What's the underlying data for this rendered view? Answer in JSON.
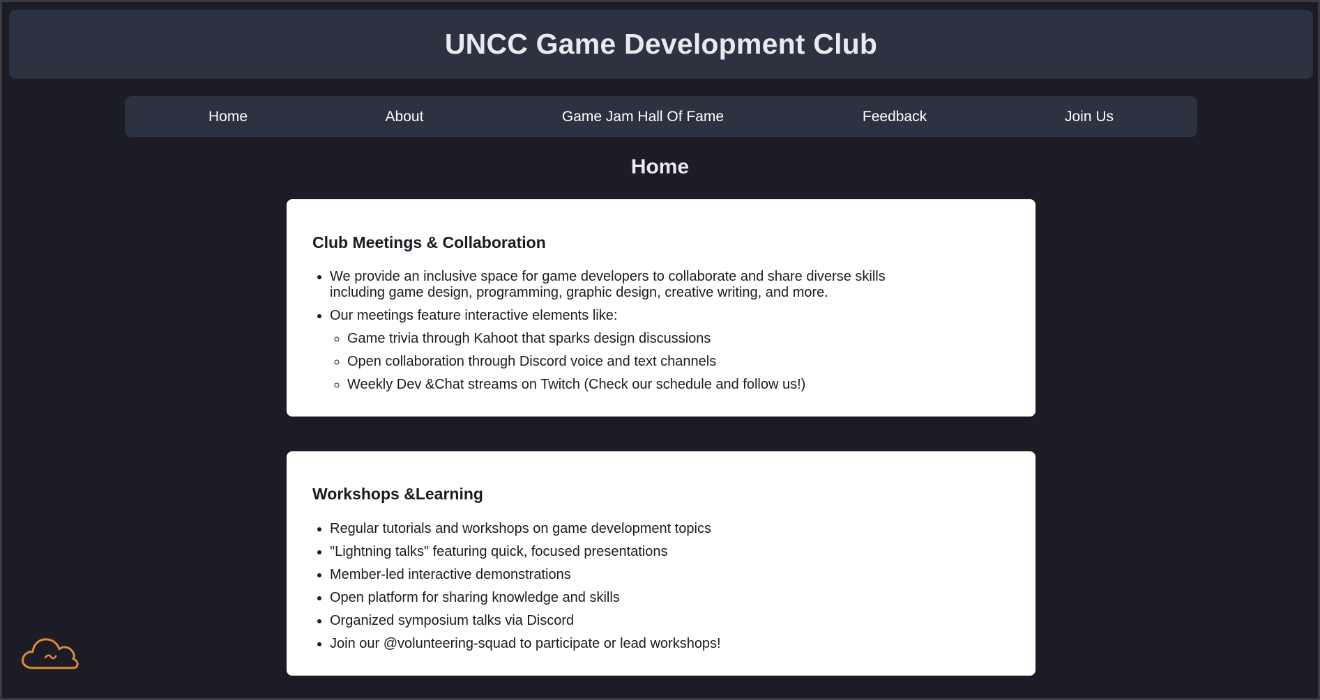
{
  "header": {
    "title": "UNCC Game Development Club"
  },
  "nav": {
    "items": [
      {
        "label": "Home"
      },
      {
        "label": "About"
      },
      {
        "label": "Game Jam Hall Of Fame"
      },
      {
        "label": "Feedback"
      },
      {
        "label": "Join Us"
      }
    ]
  },
  "page": {
    "title": "Home"
  },
  "cards": [
    {
      "title": "Club Meetings & Collaboration",
      "items": [
        "We provide an inclusive space for game developers to collaborate and share diverse skills including game design, programming, graphic design, creative writing, and more.",
        "Our meetings feature interactive elements like:"
      ],
      "subitems": [
        "Game trivia through Kahoot that sparks design discussions",
        "Open collaboration through Discord voice and text channels",
        "Weekly Dev &Chat streams on Twitch (Check our schedule and follow us!)"
      ]
    },
    {
      "title": "Workshops &Learning",
      "items": [
        "Regular tutorials and workshops on game development topics",
        "\"Lightning talks\" featuring quick, focused presentations",
        "Member-led interactive demonstrations",
        "Open platform for sharing knowledge and skills",
        "Organized symposium talks via Discord",
        "Join our @volunteering-squad to participate or lead workshops!"
      ]
    }
  ],
  "widget": {
    "icon": "cloud-icon",
    "color": "#e08a3c"
  },
  "colors": {
    "background": "#1c1c26",
    "panel": "#2c323f",
    "card": "#ffffff"
  }
}
